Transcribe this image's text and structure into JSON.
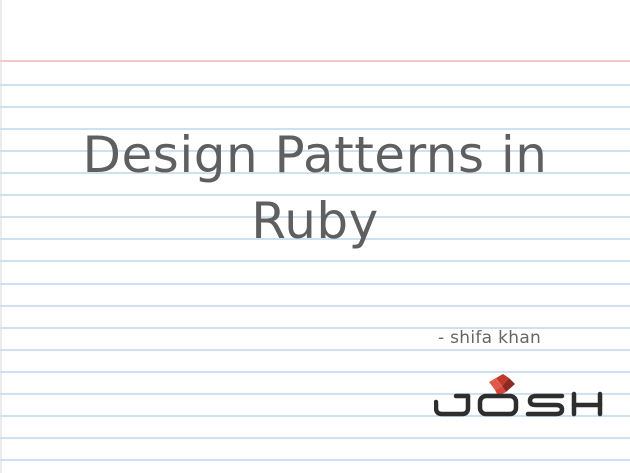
{
  "slide": {
    "title_line1": "Design Patterns in",
    "title_line2": "Ruby",
    "author": "- shifa khan",
    "logo_text": "JOSH",
    "logo_icon": "josh-diamond-icon"
  },
  "colors": {
    "ruled_line": "#cfe0f2",
    "margin_line": "#f4c8c8",
    "title_text": "#5f5f5f",
    "logo_dark": "#2e2e2e",
    "logo_red": "#c0392b"
  }
}
